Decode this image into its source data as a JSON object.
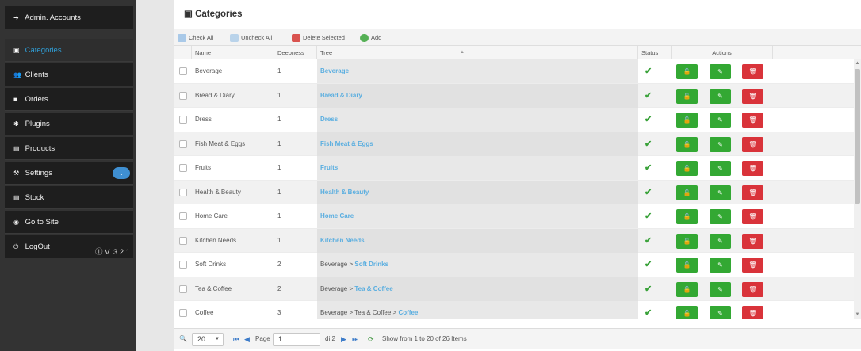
{
  "sidebar": {
    "items": [
      {
        "label": "Admin. Accounts",
        "icon": "arrow-right-icon"
      },
      {
        "label": "Categories",
        "icon": "categories-icon"
      },
      {
        "label": "Clients",
        "icon": "users-icon"
      },
      {
        "label": "Orders",
        "icon": "orders-icon"
      },
      {
        "label": "Plugins",
        "icon": "gear-icon"
      },
      {
        "label": "Products",
        "icon": "list-icon"
      },
      {
        "label": "Settings",
        "icon": "wrench-icon"
      },
      {
        "label": "Stock",
        "icon": "list-icon"
      },
      {
        "label": "Go to Site",
        "icon": "globe-icon"
      },
      {
        "label": "LogOut",
        "icon": "power-icon"
      }
    ],
    "version": "V. 3.2.1"
  },
  "page": {
    "title": "Categories"
  },
  "toolbar": {
    "check_all": "Check All",
    "uncheck_all": "Uncheck All",
    "delete_selected": "Delete Selected",
    "add": "Add"
  },
  "columns": {
    "name": "Name",
    "deepness": "Deepness",
    "tree": "Tree",
    "status": "Status",
    "actions": "Actions"
  },
  "rows": [
    {
      "name": "Beverage",
      "deepness": "1",
      "tree_prefix": "",
      "tree_link": "Beverage"
    },
    {
      "name": "Bread & Diary",
      "deepness": "1",
      "tree_prefix": "",
      "tree_link": "Bread & Diary"
    },
    {
      "name": "Dress",
      "deepness": "1",
      "tree_prefix": "",
      "tree_link": "Dress"
    },
    {
      "name": "Fish Meat & Eggs",
      "deepness": "1",
      "tree_prefix": "",
      "tree_link": "Fish Meat & Eggs"
    },
    {
      "name": "Fruits",
      "deepness": "1",
      "tree_prefix": "",
      "tree_link": "Fruits"
    },
    {
      "name": "Health & Beauty",
      "deepness": "1",
      "tree_prefix": "",
      "tree_link": "Health & Beauty"
    },
    {
      "name": "Home Care",
      "deepness": "1",
      "tree_prefix": "",
      "tree_link": "Home Care"
    },
    {
      "name": "Kitchen Needs",
      "deepness": "1",
      "tree_prefix": "",
      "tree_link": "Kitchen Needs"
    },
    {
      "name": "Soft Drinks",
      "deepness": "2",
      "tree_prefix": "Beverage > ",
      "tree_link": "Soft Drinks"
    },
    {
      "name": "Tea & Coffee",
      "deepness": "2",
      "tree_prefix": "Beverage > ",
      "tree_link": "Tea & Coffee"
    },
    {
      "name": "Coffee",
      "deepness": "3",
      "tree_prefix": "Beverage > Tea & Coffee > ",
      "tree_link": "Coffee"
    }
  ],
  "status_glyph": "✔",
  "pager": {
    "page_size": "20",
    "page_label": "Page",
    "page_value": "1",
    "of_label": "di 2",
    "summary": "Show from 1 to 20 of 26 Items"
  },
  "colors": {
    "sidebar_bg": "#333333",
    "active": "#2f9fd8",
    "link": "#5aaee0",
    "green": "#33a833",
    "red": "#d9333a"
  }
}
